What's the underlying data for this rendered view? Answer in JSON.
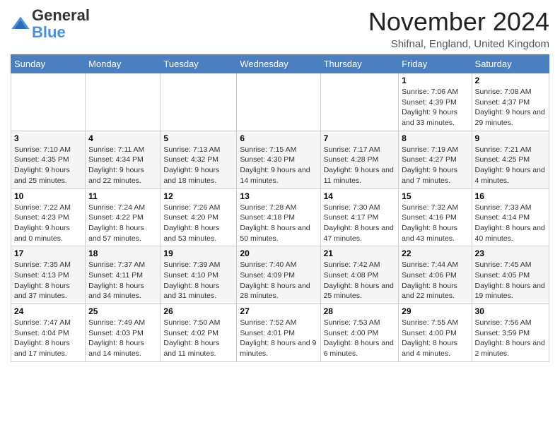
{
  "logo": {
    "line1": "General",
    "line2": "Blue"
  },
  "title": "November 2024",
  "location": "Shifnal, England, United Kingdom",
  "days_of_week": [
    "Sunday",
    "Monday",
    "Tuesday",
    "Wednesday",
    "Thursday",
    "Friday",
    "Saturday"
  ],
  "weeks": [
    [
      {
        "day": "",
        "info": ""
      },
      {
        "day": "",
        "info": ""
      },
      {
        "day": "",
        "info": ""
      },
      {
        "day": "",
        "info": ""
      },
      {
        "day": "",
        "info": ""
      },
      {
        "day": "1",
        "info": "Sunrise: 7:06 AM\nSunset: 4:39 PM\nDaylight: 9 hours and 33 minutes."
      },
      {
        "day": "2",
        "info": "Sunrise: 7:08 AM\nSunset: 4:37 PM\nDaylight: 9 hours and 29 minutes."
      }
    ],
    [
      {
        "day": "3",
        "info": "Sunrise: 7:10 AM\nSunset: 4:35 PM\nDaylight: 9 hours and 25 minutes."
      },
      {
        "day": "4",
        "info": "Sunrise: 7:11 AM\nSunset: 4:34 PM\nDaylight: 9 hours and 22 minutes."
      },
      {
        "day": "5",
        "info": "Sunrise: 7:13 AM\nSunset: 4:32 PM\nDaylight: 9 hours and 18 minutes."
      },
      {
        "day": "6",
        "info": "Sunrise: 7:15 AM\nSunset: 4:30 PM\nDaylight: 9 hours and 14 minutes."
      },
      {
        "day": "7",
        "info": "Sunrise: 7:17 AM\nSunset: 4:28 PM\nDaylight: 9 hours and 11 minutes."
      },
      {
        "day": "8",
        "info": "Sunrise: 7:19 AM\nSunset: 4:27 PM\nDaylight: 9 hours and 7 minutes."
      },
      {
        "day": "9",
        "info": "Sunrise: 7:21 AM\nSunset: 4:25 PM\nDaylight: 9 hours and 4 minutes."
      }
    ],
    [
      {
        "day": "10",
        "info": "Sunrise: 7:22 AM\nSunset: 4:23 PM\nDaylight: 9 hours and 0 minutes."
      },
      {
        "day": "11",
        "info": "Sunrise: 7:24 AM\nSunset: 4:22 PM\nDaylight: 8 hours and 57 minutes."
      },
      {
        "day": "12",
        "info": "Sunrise: 7:26 AM\nSunset: 4:20 PM\nDaylight: 8 hours and 53 minutes."
      },
      {
        "day": "13",
        "info": "Sunrise: 7:28 AM\nSunset: 4:18 PM\nDaylight: 8 hours and 50 minutes."
      },
      {
        "day": "14",
        "info": "Sunrise: 7:30 AM\nSunset: 4:17 PM\nDaylight: 8 hours and 47 minutes."
      },
      {
        "day": "15",
        "info": "Sunrise: 7:32 AM\nSunset: 4:16 PM\nDaylight: 8 hours and 43 minutes."
      },
      {
        "day": "16",
        "info": "Sunrise: 7:33 AM\nSunset: 4:14 PM\nDaylight: 8 hours and 40 minutes."
      }
    ],
    [
      {
        "day": "17",
        "info": "Sunrise: 7:35 AM\nSunset: 4:13 PM\nDaylight: 8 hours and 37 minutes."
      },
      {
        "day": "18",
        "info": "Sunrise: 7:37 AM\nSunset: 4:11 PM\nDaylight: 8 hours and 34 minutes."
      },
      {
        "day": "19",
        "info": "Sunrise: 7:39 AM\nSunset: 4:10 PM\nDaylight: 8 hours and 31 minutes."
      },
      {
        "day": "20",
        "info": "Sunrise: 7:40 AM\nSunset: 4:09 PM\nDaylight: 8 hours and 28 minutes."
      },
      {
        "day": "21",
        "info": "Sunrise: 7:42 AM\nSunset: 4:08 PM\nDaylight: 8 hours and 25 minutes."
      },
      {
        "day": "22",
        "info": "Sunrise: 7:44 AM\nSunset: 4:06 PM\nDaylight: 8 hours and 22 minutes."
      },
      {
        "day": "23",
        "info": "Sunrise: 7:45 AM\nSunset: 4:05 PM\nDaylight: 8 hours and 19 minutes."
      }
    ],
    [
      {
        "day": "24",
        "info": "Sunrise: 7:47 AM\nSunset: 4:04 PM\nDaylight: 8 hours and 17 minutes."
      },
      {
        "day": "25",
        "info": "Sunrise: 7:49 AM\nSunset: 4:03 PM\nDaylight: 8 hours and 14 minutes."
      },
      {
        "day": "26",
        "info": "Sunrise: 7:50 AM\nSunset: 4:02 PM\nDaylight: 8 hours and 11 minutes."
      },
      {
        "day": "27",
        "info": "Sunrise: 7:52 AM\nSunset: 4:01 PM\nDaylight: 8 hours and 9 minutes."
      },
      {
        "day": "28",
        "info": "Sunrise: 7:53 AM\nSunset: 4:00 PM\nDaylight: 8 hours and 6 minutes."
      },
      {
        "day": "29",
        "info": "Sunrise: 7:55 AM\nSunset: 4:00 PM\nDaylight: 8 hours and 4 minutes."
      },
      {
        "day": "30",
        "info": "Sunrise: 7:56 AM\nSunset: 3:59 PM\nDaylight: 8 hours and 2 minutes."
      }
    ]
  ]
}
